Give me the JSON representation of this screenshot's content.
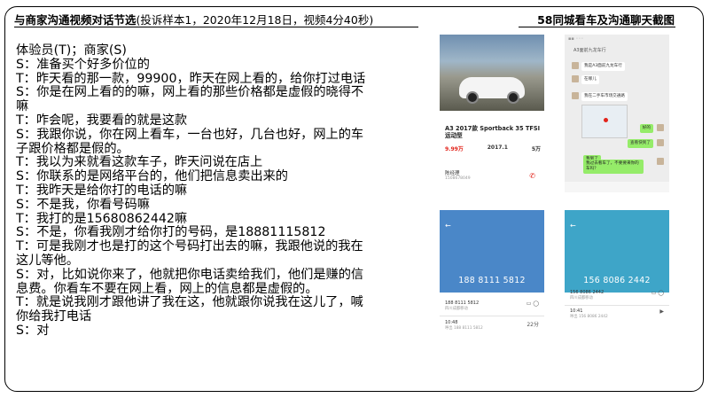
{
  "header": {
    "title": "与商家沟通视频对话节选",
    "subtitle": "(投诉样本1，2020年12月18日，视频4分40秒)",
    "right_title": "58同城看车及沟通聊天截图"
  },
  "transcript": [
    "体验员(T)；商家(S)",
    "S：准备买个好多价位的",
    "T：昨天看的那一款，99900，昨天在网上看的，给你打过电话",
    "S：你是在网上看的的嘛，网上看的那些价格都是虚假的晓得不嘛",
    "T：咋会呢，我要看的就是这款",
    "S：我跟你说，你在网上看车，一台也好，几台也好，网上的车子跟价格都是假的。",
    "T：我以为来就看这款车子，昨天问说在店上",
    "S：你联系的是网络平台的，他们把信息卖出来的",
    "T：我昨天是给你打的电话的嘛",
    "S：不是我，你看号码嘛",
    "T：我打的是15680862442嘛",
    "S：不是，你看我刚才给你打的号码，是18881115812",
    "T：可是我刚才也是打的这个号码打出去的嘛，我跟他说的我在这儿等他。",
    "S：对，比如说你来了，他就把你电话卖给我们，他们是赚的信息费。你看车不要在网上看，网上的信息都是虚假的。",
    "T：就是说我刚才跟他讲了我在这，他就跟你说我在这儿了，喊你给我打电话",
    "S：对"
  ],
  "shot_listing": {
    "title": "A3 2017款 Sportback 35 TFSI 运动型",
    "price": "9.99万",
    "year": "2017.1",
    "mileage": "5万",
    "seller": "陈经理",
    "seller_sub": "1508678049"
  },
  "shot_chat": {
    "header": "A3面前九龙车行",
    "msg1": "我是A3面前九龙车行",
    "msg2": "在哪儿",
    "msg3": "我在二手车市场交通路",
    "msg4": "好的",
    "msg5": "查看快到了",
    "msg6": "我到了",
    "msg7": "我过去看车了，不要要来你的车吗？"
  },
  "shot_call1": {
    "number": "188 8111 5812",
    "row1": "188 8111 5812",
    "row1_sub": "四川成都移动",
    "row2": "10:48",
    "row2_sub": "呼出 188 8111 5812",
    "row2_dur": "22分"
  },
  "shot_call2": {
    "number": "156 8086 2442",
    "row1": "156 8086 2442",
    "row1_sub": "四川成都移动",
    "row2": "10:41",
    "row2_sub": "呼出 156 8086 2442"
  },
  "colors": {
    "accent_green": "#95ec69",
    "price_red": "#e2231a",
    "call_blue": "#4a87c8",
    "call_teal": "#3ea5c8"
  }
}
